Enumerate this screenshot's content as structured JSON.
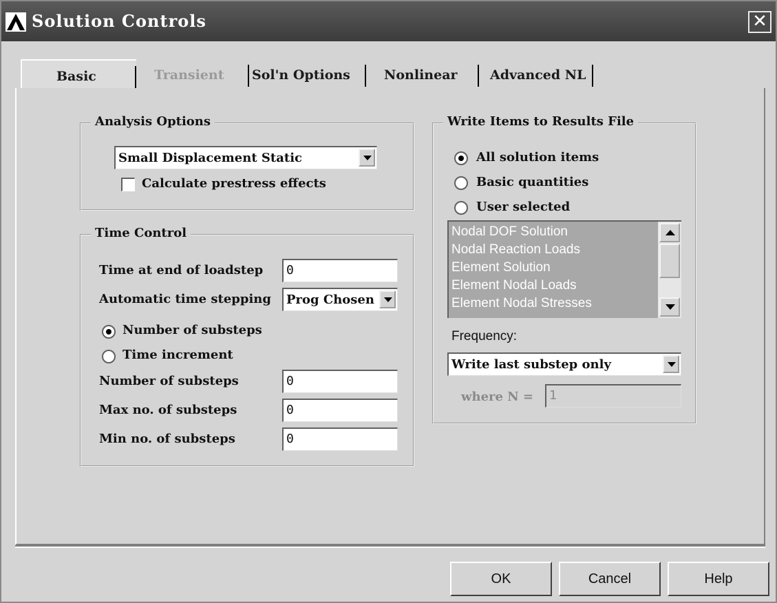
{
  "window": {
    "title": "Solution Controls",
    "close_label": "✕"
  },
  "tabs": [
    {
      "label": "Basic",
      "active": true,
      "enabled": true
    },
    {
      "label": "Transient",
      "active": false,
      "enabled": false
    },
    {
      "label": "Sol'n Options",
      "active": false,
      "enabled": true
    },
    {
      "label": "Nonlinear",
      "active": false,
      "enabled": true
    },
    {
      "label": "Advanced NL",
      "active": false,
      "enabled": true
    }
  ],
  "analysis_options": {
    "legend": "Analysis Options",
    "analysis_type": "Small Displacement Static",
    "prestress_label": "Calculate prestress effects",
    "prestress_checked": false
  },
  "time_control": {
    "legend": "Time Control",
    "time_end_label": "Time at end of loadstep",
    "time_end_value": "0",
    "auto_step_label": "Automatic time stepping",
    "auto_step_value": "Prog Chosen",
    "radio_substeps": "Number of substeps",
    "radio_increment": "Time increment",
    "selected_radio": "Number of substeps",
    "num_substeps_label": "Number of substeps",
    "num_substeps_value": "0",
    "max_substeps_label": "Max no. of substeps",
    "max_substeps_value": "0",
    "min_substeps_label": "Min no. of substeps",
    "min_substeps_value": "0"
  },
  "write_items": {
    "legend": "Write Items to Results File",
    "radio_all": "All solution items",
    "radio_basic": "Basic quantities",
    "radio_user": "User selected",
    "selected_radio": "All solution items",
    "list": [
      "Nodal DOF Solution",
      "Nodal Reaction Loads",
      "Element Solution",
      "Element Nodal Loads",
      "Element Nodal Stresses"
    ],
    "frequency_label": "Frequency:",
    "frequency_value": "Write last substep only",
    "where_label": "where N =",
    "where_value": "1"
  },
  "buttons": {
    "ok": "OK",
    "cancel": "Cancel",
    "help": "Help"
  },
  "colors": {
    "titlebar": "#4a4a4a",
    "dialog": "#d4d4d4",
    "list_bg": "#a8a8a8"
  }
}
